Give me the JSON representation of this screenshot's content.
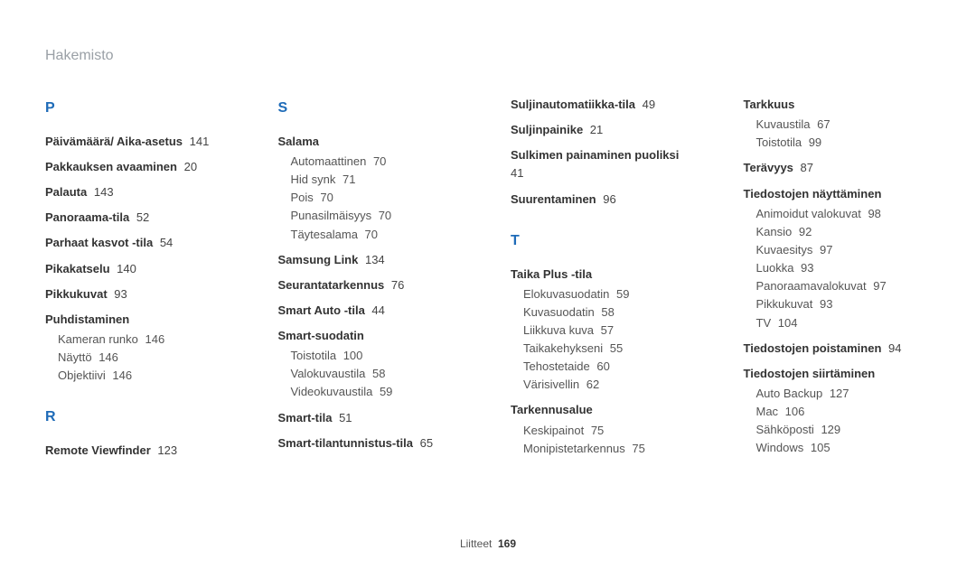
{
  "page_title": "Hakemisto",
  "footer_label": "Liitteet",
  "footer_page": "169",
  "columns": [
    {
      "sections": [
        {
          "letter": "P",
          "entries": [
            {
              "label": "Päivämäärä/ Aika-asetus",
              "page": "141"
            },
            {
              "label": "Pakkauksen avaaminen",
              "page": "20"
            },
            {
              "label": "Palauta",
              "page": "143"
            },
            {
              "label": "Panoraama-tila",
              "page": "52"
            },
            {
              "label": "Parhaat kasvot -tila",
              "page": "54"
            },
            {
              "label": "Pikakatselu",
              "page": "140"
            },
            {
              "label": "Pikkukuvat",
              "page": "93"
            },
            {
              "label": "Puhdistaminen",
              "subs": [
                {
                  "label": "Kameran runko",
                  "page": "146"
                },
                {
                  "label": "Näyttö",
                  "page": "146"
                },
                {
                  "label": "Objektiivi",
                  "page": "146"
                }
              ]
            }
          ]
        },
        {
          "letter": "R",
          "entries": [
            {
              "label": "Remote Viewfinder",
              "page": "123"
            }
          ]
        }
      ]
    },
    {
      "sections": [
        {
          "letter": "S",
          "entries": [
            {
              "label": "Salama",
              "subs": [
                {
                  "label": "Automaattinen",
                  "page": "70"
                },
                {
                  "label": "Hid synk",
                  "page": "71"
                },
                {
                  "label": "Pois",
                  "page": "70"
                },
                {
                  "label": "Punasilmäisyys",
                  "page": "70"
                },
                {
                  "label": "Täytesalama",
                  "page": "70"
                }
              ]
            },
            {
              "label": "Samsung Link",
              "page": "134"
            },
            {
              "label": "Seurantatarkennus",
              "page": "76"
            },
            {
              "label": "Smart Auto -tila",
              "page": "44"
            },
            {
              "label": "Smart-suodatin",
              "subs": [
                {
                  "label": "Toistotila",
                  "page": "100"
                },
                {
                  "label": "Valokuvaustila",
                  "page": "58"
                },
                {
                  "label": "Videokuvaustila",
                  "page": "59"
                }
              ]
            },
            {
              "label": "Smart-tila",
              "page": "51"
            },
            {
              "label": "Smart-tilantunnistus-tila",
              "page": "65"
            }
          ]
        }
      ]
    },
    {
      "sections": [
        {
          "entries": [
            {
              "label": "Suljinautomatiikka-tila",
              "page": "49"
            },
            {
              "label": "Suljinpainike",
              "page": "21"
            },
            {
              "label": "Sulkimen painaminen puoliksi",
              "page": "41"
            },
            {
              "label": "Suurentaminen",
              "page": "96"
            }
          ]
        },
        {
          "letter": "T",
          "entries": [
            {
              "label": "Taika Plus -tila",
              "subs": [
                {
                  "label": "Elokuvasuodatin",
                  "page": "59"
                },
                {
                  "label": "Kuvasuodatin",
                  "page": "58"
                },
                {
                  "label": "Liikkuva kuva",
                  "page": "57"
                },
                {
                  "label": "Taikakehykseni",
                  "page": "55"
                },
                {
                  "label": "Tehostetaide",
                  "page": "60"
                },
                {
                  "label": "Värisivellin",
                  "page": "62"
                }
              ]
            },
            {
              "label": "Tarkennusalue",
              "subs": [
                {
                  "label": "Keskipainot",
                  "page": "75"
                },
                {
                  "label": "Monipistetarkennus",
                  "page": "75"
                }
              ]
            }
          ]
        }
      ]
    },
    {
      "sections": [
        {
          "entries": [
            {
              "label": "Tarkkuus",
              "subs": [
                {
                  "label": "Kuvaustila",
                  "page": "67"
                },
                {
                  "label": "Toistotila",
                  "page": "99"
                }
              ]
            },
            {
              "label": "Terävyys",
              "page": "87"
            },
            {
              "label": "Tiedostojen näyttäminen",
              "subs": [
                {
                  "label": "Animoidut valokuvat",
                  "page": "98"
                },
                {
                  "label": "Kansio",
                  "page": "92"
                },
                {
                  "label": "Kuvaesitys",
                  "page": "97"
                },
                {
                  "label": "Luokka",
                  "page": "93"
                },
                {
                  "label": "Panoraamavalokuvat",
                  "page": "97"
                },
                {
                  "label": "Pikkukuvat",
                  "page": "93"
                },
                {
                  "label": "TV",
                  "page": "104"
                }
              ]
            },
            {
              "label": "Tiedostojen poistaminen",
              "page": "94"
            },
            {
              "label": "Tiedostojen siirtäminen",
              "subs": [
                {
                  "label": "Auto Backup",
                  "page": "127"
                },
                {
                  "label": "Mac",
                  "page": "106"
                },
                {
                  "label": "Sähköposti",
                  "page": "129"
                },
                {
                  "label": "Windows",
                  "page": "105"
                }
              ]
            }
          ]
        }
      ]
    }
  ]
}
